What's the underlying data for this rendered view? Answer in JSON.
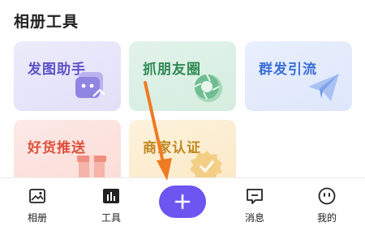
{
  "section": {
    "title": "相册工具"
  },
  "cards": [
    {
      "label": "发图助手",
      "icon": "chat-bubble-icon",
      "color": "#5d52c6"
    },
    {
      "label": "抓朋友圈",
      "icon": "camera-aperture-icon",
      "color": "#318a55"
    },
    {
      "label": "群发引流",
      "icon": "paper-plane-icon",
      "color": "#3b6ed8"
    },
    {
      "label": "好货推送",
      "icon": "gift-box-icon",
      "color": "#df4f3c"
    },
    {
      "label": "商家认证",
      "icon": "badge-check-icon",
      "color": "#c0871e"
    }
  ],
  "tabbar": {
    "tabs": [
      {
        "label": "相册",
        "icon": "image-icon"
      },
      {
        "label": "工具",
        "icon": "bar-chart-icon",
        "active": true
      },
      {
        "label": "",
        "icon": "plus-icon"
      },
      {
        "label": "消息",
        "icon": "message-icon"
      },
      {
        "label": "我的",
        "icon": "face-icon"
      }
    ]
  },
  "colors": {
    "accent": "#6c55f0",
    "annotation_arrow": "#f07a22"
  }
}
